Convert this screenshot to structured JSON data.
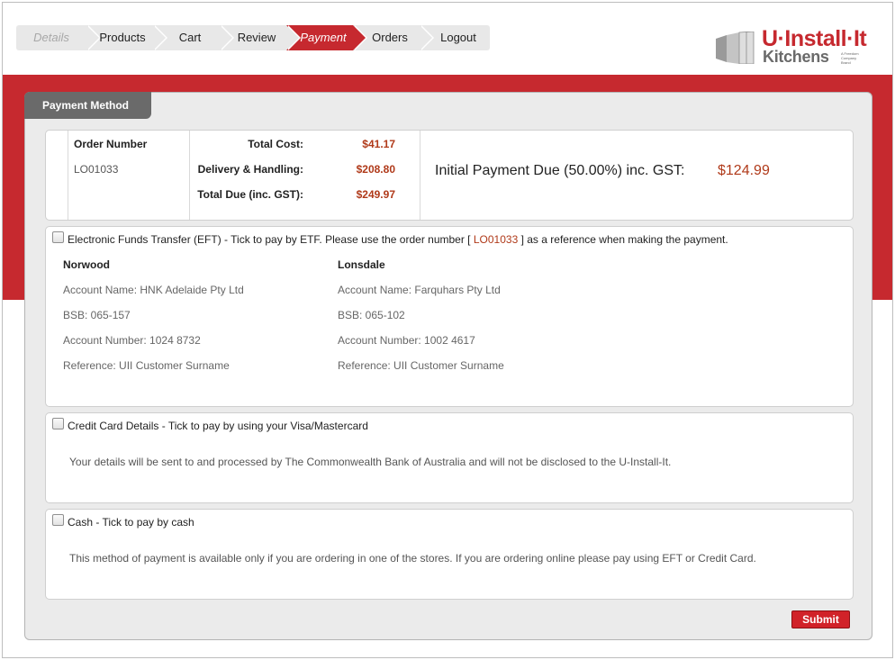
{
  "nav": {
    "steps": [
      {
        "label": "Details",
        "state": "disabled"
      },
      {
        "label": "Products",
        "state": "normal"
      },
      {
        "label": "Cart",
        "state": "normal"
      },
      {
        "label": "Review",
        "state": "normal"
      },
      {
        "label": "Payment",
        "state": "active"
      },
      {
        "label": "Orders",
        "state": "normal"
      },
      {
        "label": "Logout",
        "state": "normal"
      }
    ]
  },
  "logo": {
    "line1": "U·Install·It",
    "line2": "Kitchens",
    "tagline": "A Freedom Company Brand"
  },
  "colors": {
    "brand_red": "#c6292f",
    "amount_red": "#b03a1a",
    "panel_grey": "#ebebeb",
    "tab_grey": "#6a6a6a"
  },
  "panel": {
    "title": "Payment Method"
  },
  "order": {
    "number_label": "Order Number",
    "number_value": "LO01033",
    "total_cost_label": "Total Cost:",
    "total_cost_value": "$41.17",
    "delivery_label": "Delivery & Handling:",
    "delivery_value": "$208.80",
    "total_due_label": "Total Due (inc. GST):",
    "total_due_value": "$249.97",
    "initial_label": "Initial Payment Due (50.00%) inc. GST:",
    "initial_value": "$124.99"
  },
  "eft": {
    "title_before": "Electronic Funds Transfer (EFT) - Tick to pay by ETF. Please use the order number [",
    "title_ref": "LO01033",
    "title_after": "] as a reference when making the payment.",
    "checked": false,
    "branches": [
      {
        "name": "Norwood",
        "account_name": "Account Name: HNK Adelaide Pty Ltd",
        "bsb": "BSB: 065-157",
        "account_number": "Account Number: 1024 8732",
        "reference": "Reference: UII Customer Surname"
      },
      {
        "name": "Lonsdale",
        "account_name": "Account Name: Farquhars Pty Ltd",
        "bsb": "BSB: 065-102",
        "account_number": "Account Number: 1002 4617",
        "reference": "Reference: UII Customer Surname"
      }
    ]
  },
  "credit_card": {
    "title": "Credit Card Details - Tick to pay by using your Visa/Mastercard",
    "note": "Your details will be sent to and processed by The Commonwealth Bank of Australia and will not be disclosed to the U-Install-It.",
    "checked": false
  },
  "cash": {
    "title": "Cash - Tick to pay by cash",
    "note": "This method of payment is available only if you are ordering in one of the stores. If you are ordering online please pay using EFT or Credit Card.",
    "checked": false
  },
  "submit_label": "Submit"
}
